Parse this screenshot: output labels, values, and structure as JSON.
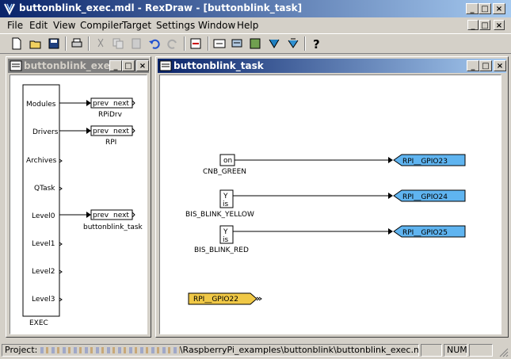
{
  "window": {
    "title": "buttonblink_exec.mdl - RexDraw - [buttonblink_task]"
  },
  "menu": [
    "File",
    "Edit",
    "View",
    "Compiler",
    "Target",
    "Settings",
    "Window",
    "Help"
  ],
  "toolbar_icons": [
    "new-icon",
    "open-icon",
    "save-icon",
    "print-icon",
    "cut-icon",
    "copy-icon",
    "paste-icon",
    "undo-icon",
    "redo-icon",
    "compile-icon",
    "download-icon",
    "connect-icon",
    "watch-icon",
    "diagnostics-icon",
    "help-icon"
  ],
  "left_window": {
    "title": "buttonblink_exec",
    "exec_block": {
      "name": "EXEC",
      "ports": [
        "Modules",
        "Drivers",
        "Archives",
        "QTask",
        "Level0",
        "Level1",
        "Level2",
        "Level3"
      ]
    },
    "connected_blocks": [
      {
        "ports": [
          "prev",
          "next"
        ],
        "label": "RPiDrv"
      },
      {
        "ports": [
          "prev",
          "next"
        ],
        "label": "RPI"
      },
      {
        "ports": [
          "prev",
          "next"
        ],
        "label": "buttonblink_task"
      }
    ]
  },
  "right_window": {
    "title": "buttonblink_task",
    "blocks": [
      {
        "text": "on",
        "label": "CNB_GREEN",
        "output": "RPI__GPIO23"
      },
      {
        "text": "Y",
        "sub": "is",
        "label": "BIS_BLINK_YELLOW",
        "output": "RPI__GPIO24"
      },
      {
        "text": "Y",
        "sub": "is",
        "label": "BIS_BLINK_RED",
        "output": "RPI__GPIO25"
      }
    ],
    "input": {
      "label": "RPI__GPIO22"
    }
  },
  "status": {
    "prefix": "Project:",
    "path": "\\RaspberryPi_examples\\buttonblink\\buttonblink_exec.mdl",
    "num": "NUM"
  },
  "colors": {
    "output_flag": "#5fb4f0",
    "input_flag": "#f0c846",
    "title_active": "#0a246a",
    "title_gradient_end": "#a6caf0"
  }
}
